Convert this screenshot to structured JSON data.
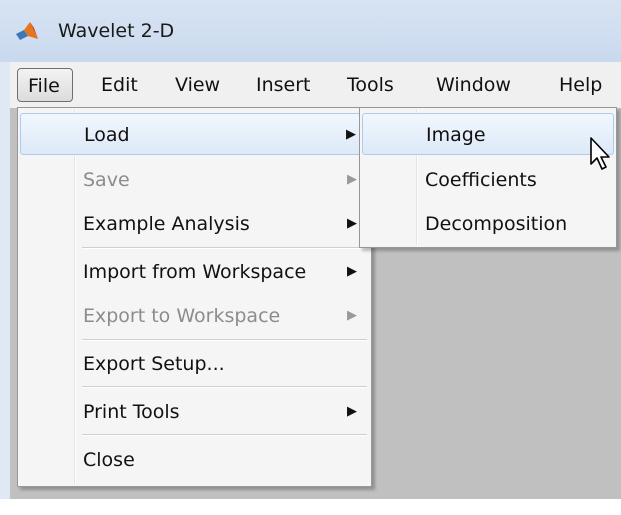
{
  "window": {
    "title": "Wavelet 2-D",
    "icon": "matlab-logo-icon"
  },
  "menubar": [
    "File",
    "Edit",
    "View",
    "Insert",
    "Tools",
    "Window",
    "Help"
  ],
  "file_menu": {
    "items": [
      {
        "label": "Load",
        "has_submenu": true,
        "enabled": true,
        "highlighted": true
      },
      {
        "label": "Save",
        "has_submenu": true,
        "enabled": false
      },
      {
        "label": "Example Analysis",
        "has_submenu": true,
        "enabled": true
      },
      {
        "label": "Import from Workspace",
        "has_submenu": true,
        "enabled": true
      },
      {
        "label": "Export to Workspace",
        "has_submenu": true,
        "enabled": false
      },
      {
        "label": "Export Setup...",
        "has_submenu": false,
        "enabled": true
      },
      {
        "label": "Print Tools",
        "has_submenu": true,
        "enabled": true
      },
      {
        "label": "Close",
        "has_submenu": false,
        "enabled": true
      }
    ]
  },
  "load_submenu": {
    "items": [
      {
        "label": "Image",
        "highlighted": true
      },
      {
        "label": "Coefficients"
      },
      {
        "label": "Decomposition"
      }
    ]
  },
  "icons": {
    "submenu_arrow": "▶",
    "cursor": "mouse-pointer-icon"
  },
  "colors": {
    "canvas": "#c0c0c0",
    "hover_border": "#aecbee",
    "titlebar": "#d8e4f3"
  }
}
